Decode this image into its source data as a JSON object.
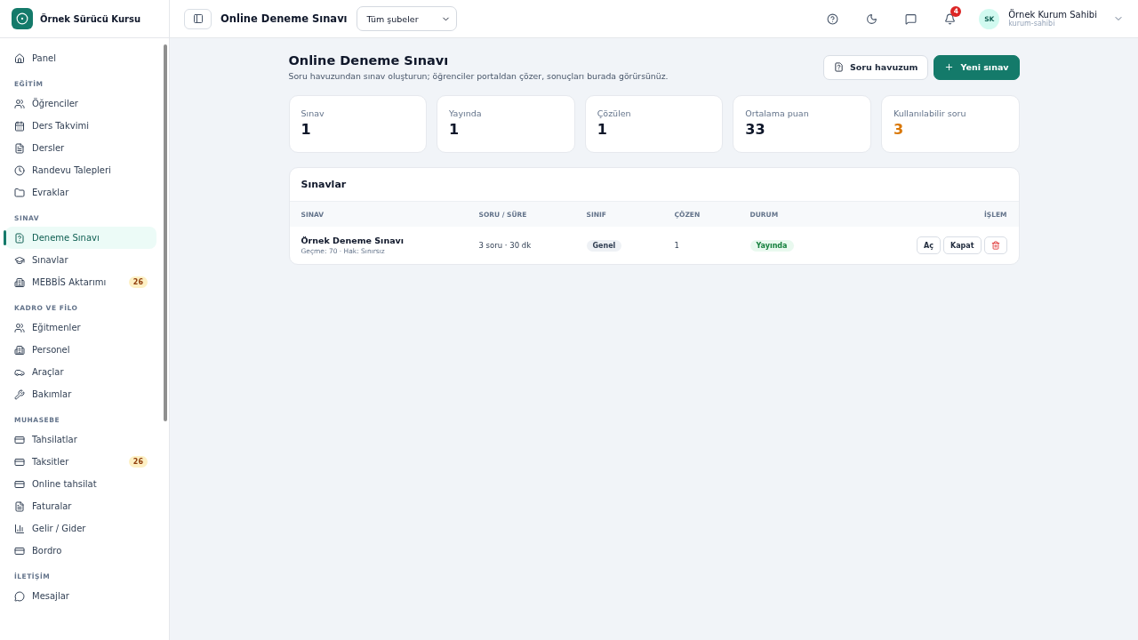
{
  "brand": {
    "name": "Örnek Sürücü Kursu"
  },
  "sidebar": {
    "sections": [
      {
        "items": [
          {
            "label": "Panel",
            "selected": false
          }
        ]
      },
      {
        "title": "EĞİTİM",
        "items": [
          {
            "label": "Öğrenciler",
            "selected": false
          },
          {
            "label": "Ders Takvimi",
            "selected": false
          },
          {
            "label": "Dersler",
            "selected": false
          },
          {
            "label": "Randevu Talepleri",
            "selected": false
          },
          {
            "label": "Evraklar",
            "selected": false
          }
        ]
      },
      {
        "title": "SINAV",
        "items": [
          {
            "label": "Deneme Sınavı",
            "selected": true
          },
          {
            "label": "Sınavlar",
            "selected": false
          },
          {
            "label": "MEBBİS Aktarımı",
            "selected": false,
            "badge": "26"
          }
        ]
      },
      {
        "title": "KADRO VE FİLO",
        "items": [
          {
            "label": "Eğitmenler",
            "selected": false
          },
          {
            "label": "Personel",
            "selected": false
          },
          {
            "label": "Araçlar",
            "selected": false
          },
          {
            "label": "Bakımlar",
            "selected": false
          }
        ]
      },
      {
        "title": "MUHASEBE",
        "items": [
          {
            "label": "Tahsilatlar",
            "selected": false
          },
          {
            "label": "Taksitler",
            "selected": false,
            "badge": "26"
          },
          {
            "label": "Online tahsilat",
            "selected": false
          },
          {
            "label": "Faturalar",
            "selected": false
          },
          {
            "label": "Gelir / Gider",
            "selected": false
          },
          {
            "label": "Bordro",
            "selected": false
          }
        ]
      },
      {
        "title": "İLETİŞİM",
        "items": [
          {
            "label": "Mesajlar",
            "selected": false
          }
        ]
      }
    ]
  },
  "header": {
    "title": "Online Deneme Sınavı",
    "branch_select": "Tüm şubeler",
    "notifications": "4",
    "user": {
      "initials": "SK",
      "name": "Örnek Kurum Sahibi",
      "handle": "kurum-sahibi"
    }
  },
  "page": {
    "title": "Online Deneme Sınavı",
    "subtitle": "Soru havuzundan sınav oluşturun; öğrenciler portaldan çözer, sonuçları burada görürsünüz.",
    "buttons": [
      {
        "label": "Soru havuzum",
        "kind": "secondary"
      },
      {
        "label": "Yeni sınav",
        "kind": "primary"
      }
    ]
  },
  "stats": [
    {
      "label": "Sınav",
      "value": "1",
      "color": "#0f172a"
    },
    {
      "label": "Yayında",
      "value": "1",
      "color": "#0f172a"
    },
    {
      "label": "Çözülen",
      "value": "1",
      "color": "#0f172a"
    },
    {
      "label": "Ortalama puan",
      "value": "33",
      "color": "#0f172a"
    },
    {
      "label": "Kullanılabilir soru",
      "value": "3",
      "color": "#d97706"
    }
  ],
  "table": {
    "title": "Sınavlar",
    "columns": [
      "SINAV",
      "SORU / SÜRE",
      "SINIF",
      "ÇÖZEN",
      "DURUM",
      "İŞLEM"
    ],
    "rows": [
      {
        "name": "Örnek Deneme Sınavı",
        "meta": "Geçme: 70 · Hak: Sınırsız",
        "size": "3 soru · 30 dk",
        "class": "Genel",
        "solved": "1",
        "status": "Yayında",
        "actions": [
          "Aç",
          "Kapat"
        ]
      }
    ]
  }
}
